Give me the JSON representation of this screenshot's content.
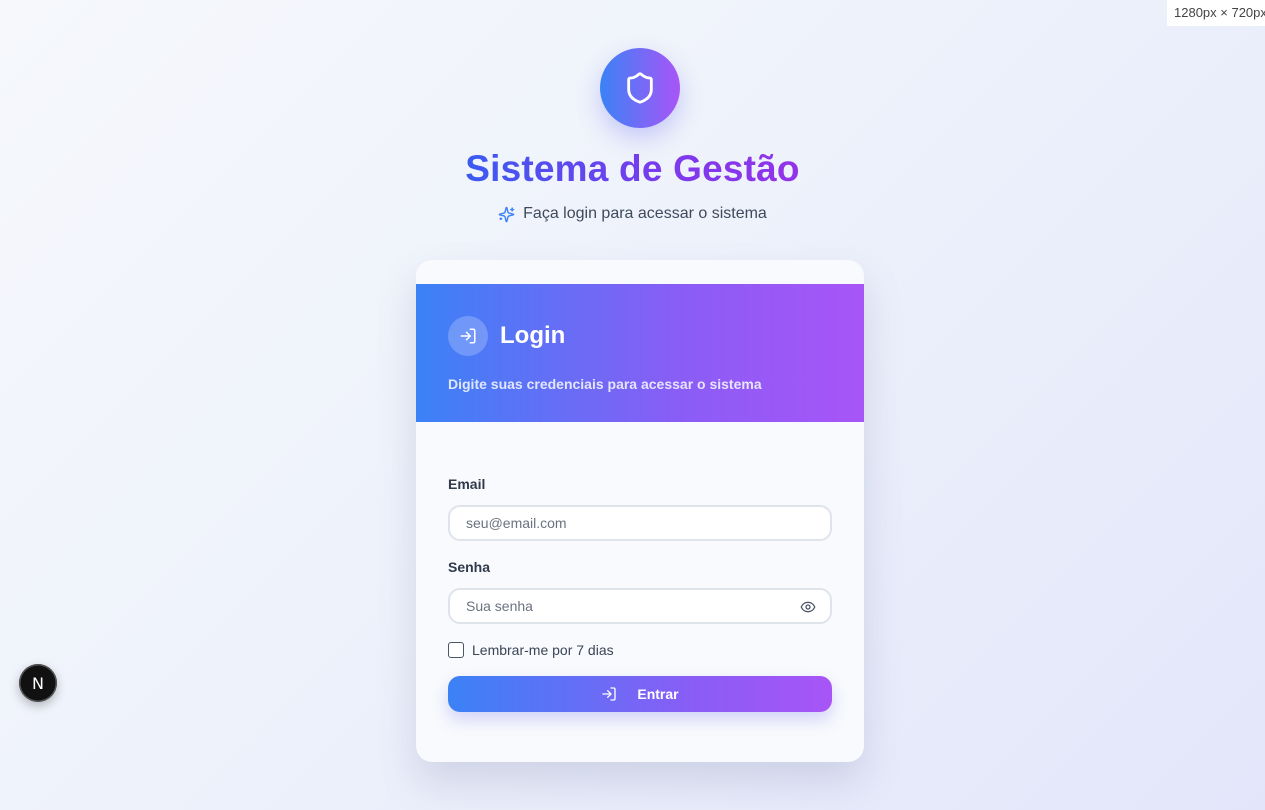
{
  "viewport_label": "1280px × 720px",
  "header": {
    "icon": "shield-icon",
    "title": "Sistema de Gestão",
    "subtitle_icon": "sparkles-icon",
    "subtitle": "Faça login para acessar o sistema"
  },
  "card": {
    "icon": "login-icon",
    "title": "Login",
    "description": "Digite suas credenciais para acessar o sistema"
  },
  "form": {
    "email_label": "Email",
    "email_placeholder": "seu@email.com",
    "email_value": "",
    "password_label": "Senha",
    "password_placeholder": "Sua senha",
    "password_value": "",
    "toggle_icon": "eye-icon",
    "remember_label": "Lembrar-me por 7 dias",
    "remember_checked": false,
    "submit_label": "Entrar"
  },
  "dev_badge": {
    "label": "N"
  },
  "colors": {
    "gradient_start": "#3b82f6",
    "gradient_end": "#a855f7",
    "title_start": "#3b5bf0",
    "title_end": "#9333ea"
  }
}
